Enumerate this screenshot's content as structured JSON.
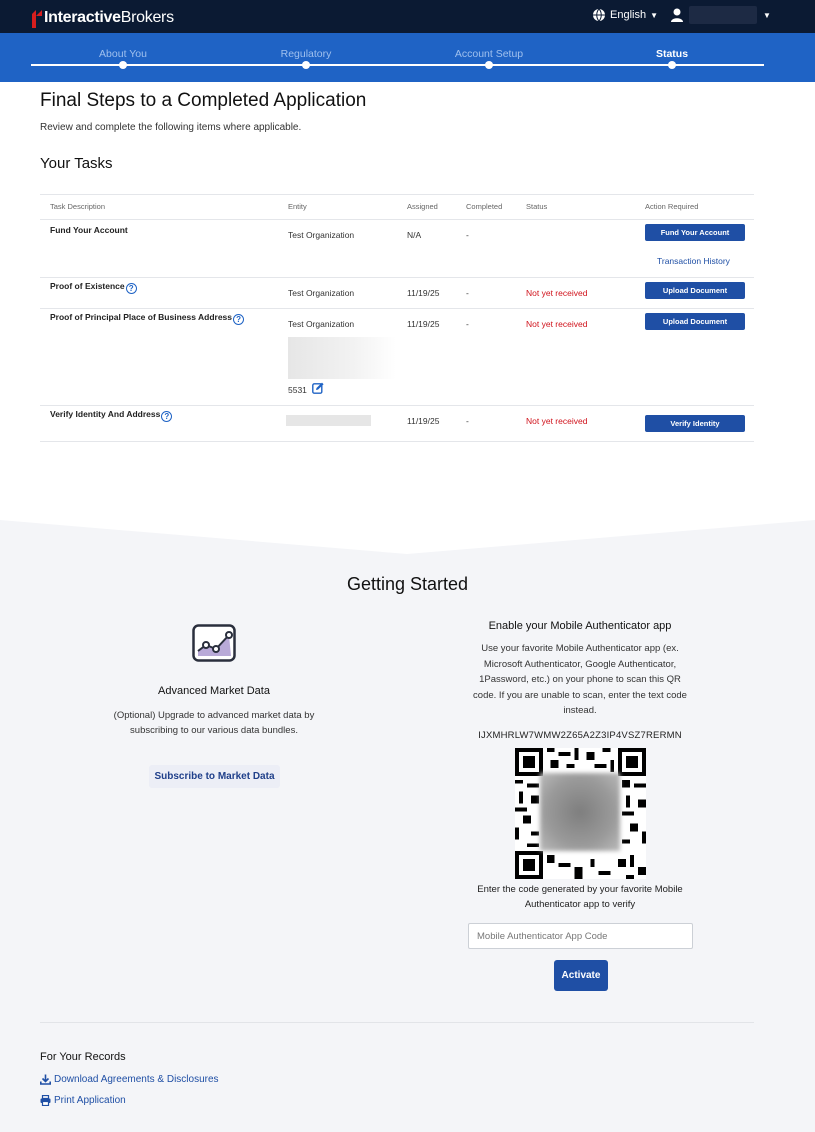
{
  "header": {
    "brand_bold": "Interactive",
    "brand_light": "Brokers",
    "language": "English"
  },
  "steps": [
    {
      "label": "About You",
      "active": false
    },
    {
      "label": "Regulatory",
      "active": false
    },
    {
      "label": "Account Setup",
      "active": false
    },
    {
      "label": "Status",
      "active": true
    }
  ],
  "page": {
    "title": "Final Steps to a Completed Application",
    "subtitle": "Review and complete the following items where applicable.",
    "tasks_title": "Your Tasks"
  },
  "table": {
    "headers": [
      "Task Description",
      "Entity",
      "Assigned",
      "Completed",
      "Status",
      "Action Required"
    ],
    "rows": [
      {
        "task": "Fund Your Account",
        "entity": "Test Organization",
        "assigned": "N/A",
        "completed": "-",
        "status": "",
        "action": "Fund Your Account",
        "secondary_link": "Transaction History"
      },
      {
        "task": "Proof of Existence",
        "entity": "Test Organization",
        "assigned": "11/19/25",
        "completed": "-",
        "status": "Not yet received",
        "action": "Upload Document"
      },
      {
        "task": "Proof of Principal Place of Business Address",
        "entity": "Test Organization",
        "assigned": "11/19/25",
        "completed": "-",
        "status": "Not yet received",
        "action": "Upload Document",
        "entity_extra": "5531"
      },
      {
        "task": "Verify Identity And Address",
        "entity": "",
        "assigned": "11/19/25",
        "completed": "-",
        "status": "Not yet received",
        "action": "Verify Identity"
      }
    ]
  },
  "getting_started": {
    "title": "Getting Started",
    "market_data": {
      "title": "Advanced Market Data",
      "description": "(Optional) Upgrade to advanced market data by subscribing to our various data bundles.",
      "button": "Subscribe to Market Data"
    },
    "authenticator": {
      "title": "Enable your Mobile Authenticator app",
      "description": "Use your favorite Mobile Authenticator app (ex. Microsoft Authenticator, Google Authenticator, 1Password, etc.) on your phone to scan this QR code. If you are unable to scan, enter the text code instead.",
      "code": "IJXMHRLW7WMW2Z65A2Z3IP4VSZ7RERMN",
      "enter_text": "Enter the code generated by your favorite Mobile Authenticator app to verify",
      "input_placeholder": "Mobile Authenticator App Code",
      "button": "Activate"
    }
  },
  "records": {
    "title": "For Your Records",
    "download": "Download Agreements & Disclosures",
    "print": "Print Application"
  },
  "colors": {
    "navbar": "#0b1a33",
    "stepbar": "#1f63c5",
    "primary_button": "#1f4fa5",
    "status_red": "#d0121b"
  }
}
